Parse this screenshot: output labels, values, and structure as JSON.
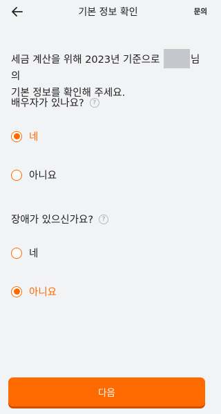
{
  "header": {
    "title": "기본 정보 확인",
    "inquiry_label": "문의"
  },
  "intro": {
    "line1_before_name": "세금 계산을 위해 2023년 기준으로",
    "line1_after_name": "님의",
    "line2": "기본 정보를 확인해 주세요."
  },
  "questions": [
    {
      "text": "배우자가 있나요?",
      "options": [
        {
          "label": "네",
          "checked": true
        },
        {
          "label": "아니요",
          "checked": false
        }
      ]
    },
    {
      "text": "장애가 있으신가요?",
      "options": [
        {
          "label": "네",
          "checked": false
        },
        {
          "label": "아니요",
          "checked": true
        }
      ]
    }
  ],
  "help_icon_glyph": "?",
  "next_button_label": "다음",
  "colors": {
    "accent": "#ff6a00",
    "background": "#f2f3f5",
    "masked": "#c5c7cc"
  }
}
